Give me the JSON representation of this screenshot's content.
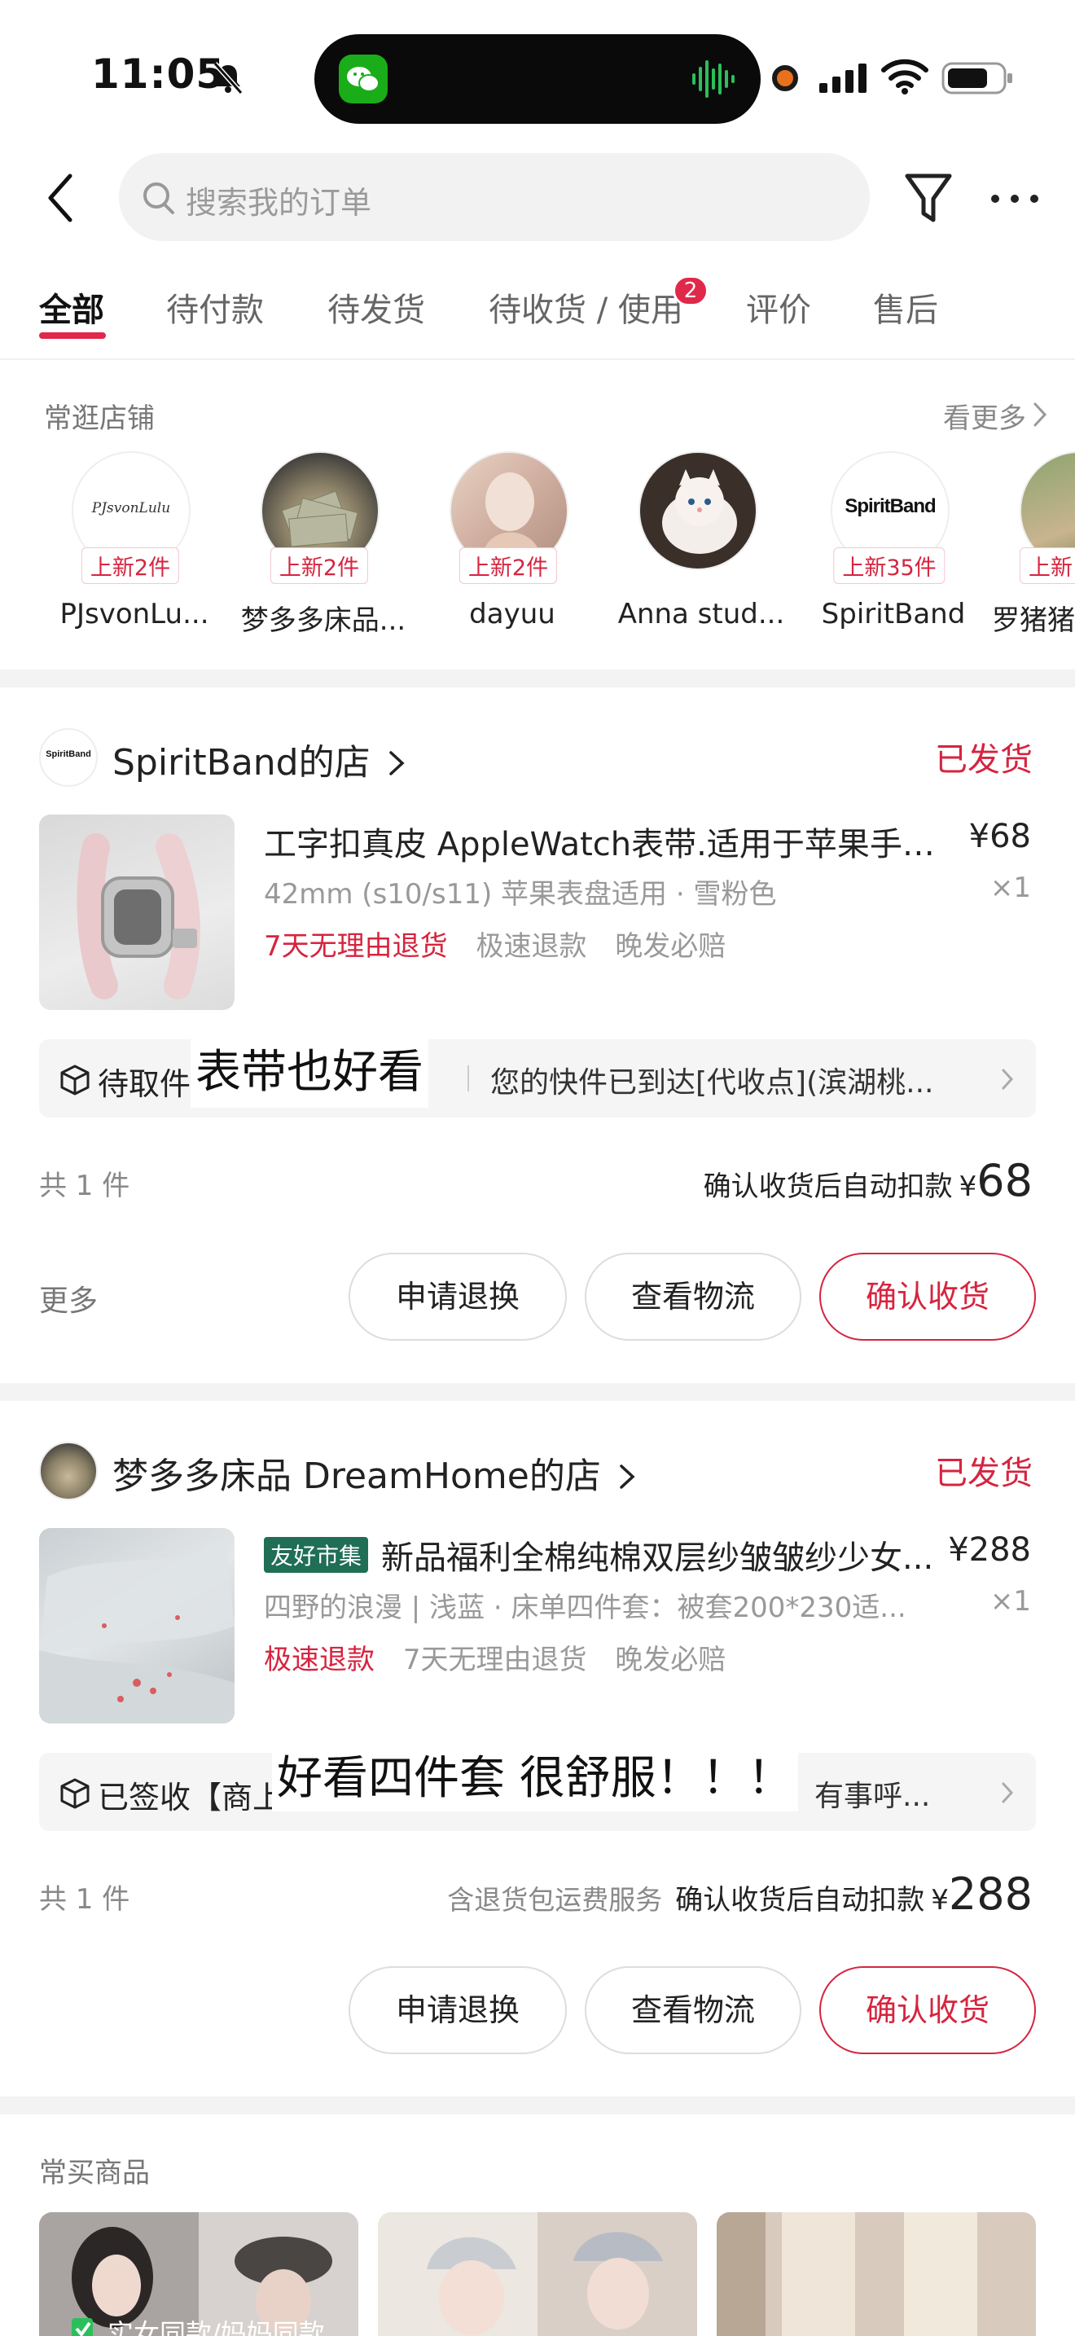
{
  "status_bar": {
    "time": "11:05"
  },
  "search": {
    "placeholder": "搜索我的订单"
  },
  "tabs": [
    {
      "label": "全部",
      "active": true
    },
    {
      "label": "待付款"
    },
    {
      "label": "待发货"
    },
    {
      "label": "待收货 / 使用",
      "badge": "2"
    },
    {
      "label": "评价"
    },
    {
      "label": "售后"
    }
  ],
  "frequent_shops": {
    "title": "常逛店铺",
    "see_more": "看更多",
    "items": [
      {
        "name": "PJsvonLu...",
        "new": "上新2件",
        "logo_text": "PJsvonLulu"
      },
      {
        "name": "梦多多床品...",
        "new": "上新2件"
      },
      {
        "name": "dayuu",
        "new": "上新2件"
      },
      {
        "name": "Anna stud...",
        "new": ""
      },
      {
        "name": "SpiritBand",
        "new": "上新35件",
        "logo_text": "SpiritBand"
      },
      {
        "name": "罗猪猪",
        "new": "上新"
      }
    ]
  },
  "orders": [
    {
      "shop": "SpiritBand的店",
      "shop_logo_text": "SpiritBand",
      "status": "已发货",
      "title": "工字扣真皮 AppleWatch表带.适用于苹果手表...",
      "price": "¥68",
      "spec": "42mm (s10/s11) 苹果表盘适用 · 雪粉色",
      "qty": "×1",
      "tags": [
        "7天无理由退货",
        "极速退款",
        "晚发必赔"
      ],
      "logistics_state": "待取件",
      "logistics_text": "您的快件已到达[代收点](滨湖桃...",
      "overlay": "表带也好看",
      "count": "共 1 件",
      "note": "",
      "total_label": "确认收货后自动扣款",
      "currency": "¥",
      "total": "68",
      "more": "更多",
      "buttons": [
        "申请退换",
        "查看物流",
        "确认收货"
      ]
    },
    {
      "shop": "梦多多床品 DreamHome的店",
      "status": "已发货",
      "market_tag": "友好市集",
      "title": "新品福利全棉纯棉双层纱皱皱纱少女...",
      "price": "¥288",
      "spec": "四野的浪漫 | 浅蓝 · 床单四件套：被套200*230适...",
      "qty": "×1",
      "tags": [
        "极速退款",
        "7天无理由退货",
        "晚发必赔"
      ],
      "logistics_state": "已签收【商上",
      "logistics_text": "台，有事呼...",
      "overlay": "好看四件套 很舒服！！！",
      "count": "共 1 件",
      "note": "含退货包运费服务",
      "total_label": "确认收货后自动扣款",
      "currency": "¥",
      "total": "288",
      "buttons": [
        "申请退换",
        "查看物流",
        "确认收货"
      ]
    }
  ],
  "frequent_goods": {
    "title": "常买商品",
    "first_caption": "实女同款/妈妈同款"
  },
  "colors": {
    "accent": "#d6243f",
    "tag_green": "#1f6e55"
  }
}
